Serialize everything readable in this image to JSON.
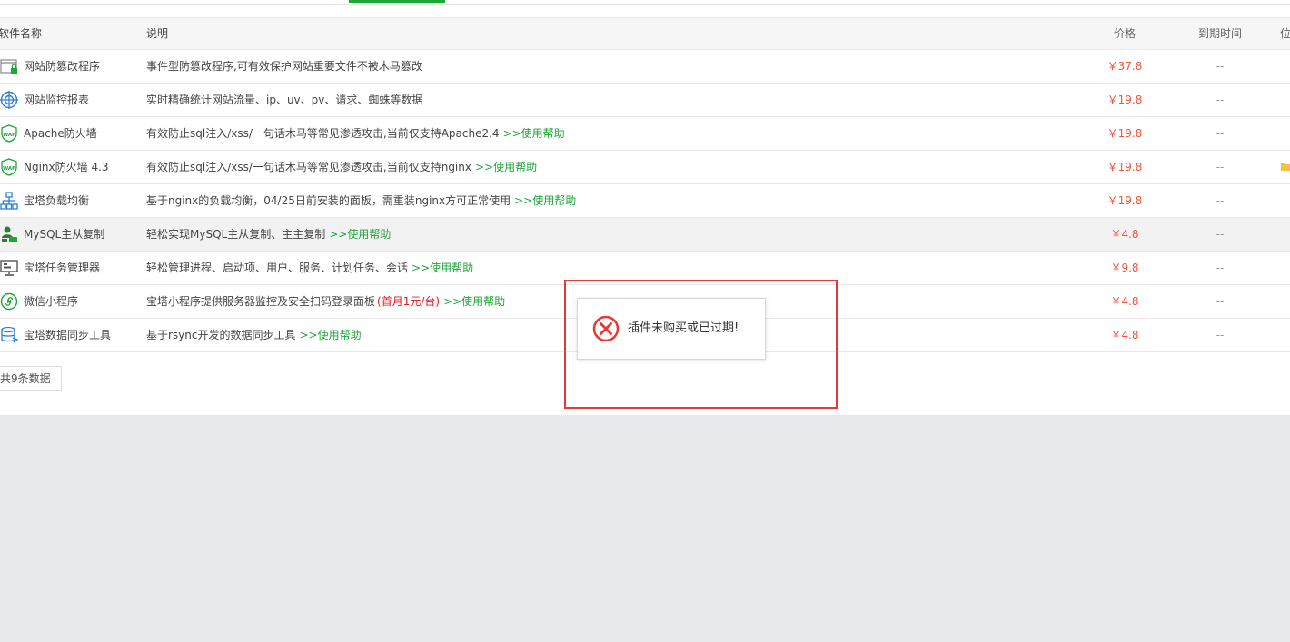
{
  "table": {
    "headers": {
      "name": "软件名称",
      "description": "说明",
      "price": "价格",
      "expire": "到期时间",
      "position": "位"
    },
    "rows": [
      {
        "name": "网站防篡改程序",
        "description": "事件型防篡改程序,可有效保护网站重要文件不被木马篡改",
        "promo": "",
        "help": "",
        "price": "￥37.8",
        "expire": "--",
        "icon": "tamper-proof-icon"
      },
      {
        "name": "网站监控报表",
        "description": "实时精确统计网站流量、ip、uv、pv、请求、蜘蛛等数据",
        "promo": "",
        "help": "",
        "price": "￥19.8",
        "expire": "--",
        "icon": "monitor-report-icon"
      },
      {
        "name": "Apache防火墙",
        "description": "有效防止sql注入/xss/一句话木马等常见渗透攻击,当前仅支持Apache2.4",
        "promo": "",
        "help": ">>使用帮助",
        "price": "￥19.8",
        "expire": "--",
        "icon": "waf-shield-icon"
      },
      {
        "name": "Nginx防火墙 4.3",
        "description": "有效防止sql注入/xss/一句话木马等常见渗透攻击,当前仅支持nginx",
        "promo": "",
        "help": ">>使用帮助",
        "price": "￥19.8",
        "expire": "--",
        "icon": "waf-shield-icon"
      },
      {
        "name": "宝塔负载均衡",
        "description": "基于nginx的负载均衡，04/25日前安装的面板，需重装nginx方可正常使用",
        "promo": "",
        "help": ">>使用帮助",
        "price": "￥19.8",
        "expire": "--",
        "icon": "load-balance-icon"
      },
      {
        "name": "MySQL主从复制",
        "description": "轻松实现MySQL主从复制、主主复制",
        "promo": "",
        "help": ">>使用帮助",
        "price": "￥4.8",
        "expire": "--",
        "icon": "mysql-replication-icon"
      },
      {
        "name": "宝塔任务管理器",
        "description": "轻松管理进程、启动项、用户、服务、计划任务、会话",
        "promo": "",
        "help": ">>使用帮助",
        "price": "￥9.8",
        "expire": "--",
        "icon": "task-manager-icon"
      },
      {
        "name": "微信小程序",
        "description": "宝塔小程序提供服务器监控及安全扫码登录面板",
        "promo": "(首月1元/台)",
        "help": ">>使用帮助",
        "price": "￥4.8",
        "expire": "--",
        "icon": "wechat-miniapp-icon"
      },
      {
        "name": "宝塔数据同步工具",
        "description": "基于rsync开发的数据同步工具",
        "promo": "",
        "help": ">>使用帮助",
        "price": "￥4.8",
        "expire": "--",
        "icon": "data-sync-icon"
      }
    ]
  },
  "footer": {
    "count": "共9条数据"
  },
  "toast": {
    "message": "插件未购买或已过期!",
    "icon": "error-circle-icon"
  },
  "colors": {
    "accent": "#20a53a",
    "price": "#f0553f",
    "promo": "#e0181f",
    "error": "#e53935"
  }
}
